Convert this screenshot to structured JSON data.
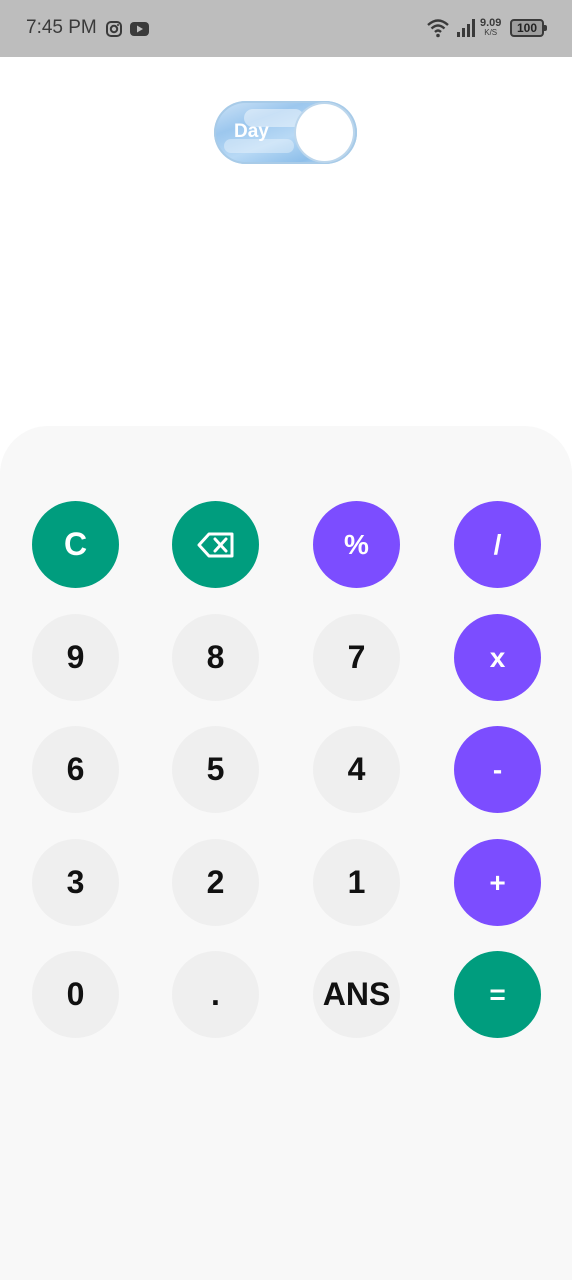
{
  "status_bar": {
    "time": "7:45 PM",
    "net_speed_value": "9.09",
    "net_speed_unit": "K/S",
    "battery": "100",
    "icons": [
      "instagram-icon",
      "youtube-icon",
      "wifi-icon",
      "signal-icon",
      "battery-icon"
    ]
  },
  "theme_toggle": {
    "label": "Day",
    "state": "on"
  },
  "colors": {
    "accent_green": "#009d7e",
    "accent_purple": "#7c4dff",
    "digit_key_bg": "#efefef",
    "keypad_bg": "#f8f8f8"
  },
  "keypad": {
    "rows": [
      [
        {
          "label": "C"
        },
        {
          "label": "",
          "icon": "backspace-icon"
        },
        {
          "label": "%"
        },
        {
          "label": "/"
        }
      ],
      [
        {
          "label": "9"
        },
        {
          "label": "8"
        },
        {
          "label": "7"
        },
        {
          "label": "x"
        }
      ],
      [
        {
          "label": "6"
        },
        {
          "label": "5"
        },
        {
          "label": "4"
        },
        {
          "label": "-"
        }
      ],
      [
        {
          "label": "3"
        },
        {
          "label": "2"
        },
        {
          "label": "1"
        },
        {
          "label": "+"
        }
      ],
      [
        {
          "label": "0"
        },
        {
          "label": "."
        },
        {
          "label": "ANS"
        },
        {
          "label": "="
        }
      ]
    ]
  }
}
